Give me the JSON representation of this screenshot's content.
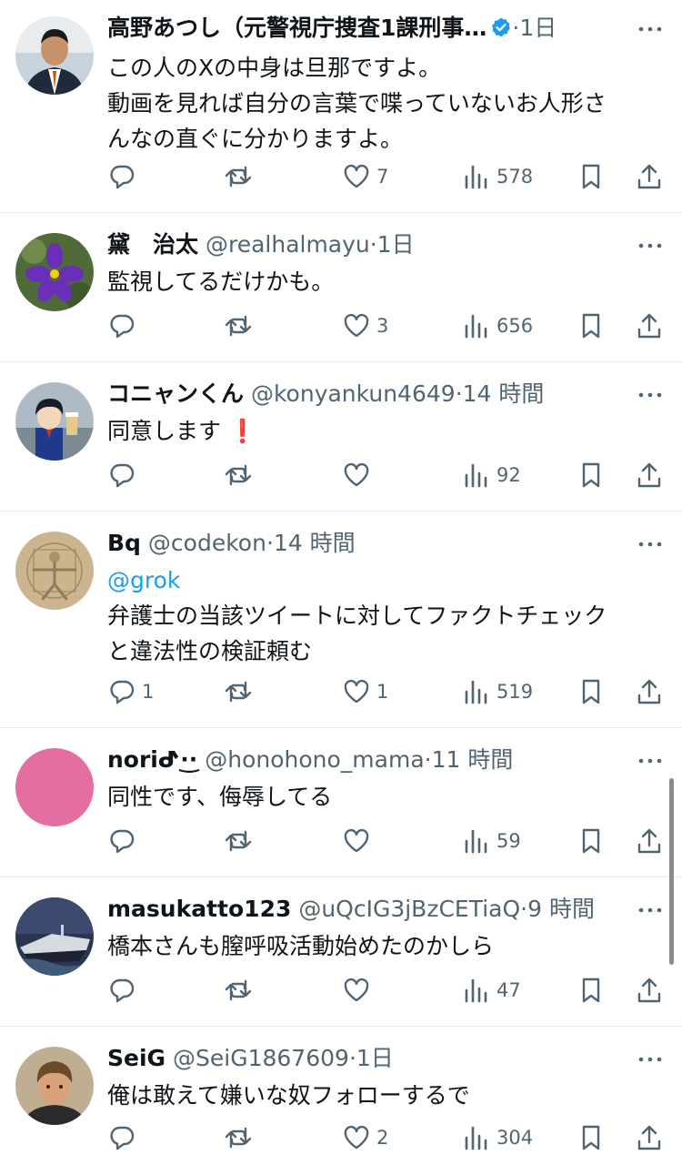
{
  "tweets": [
    {
      "name": "高野あつし（元警視庁捜査1課刑事…",
      "handle": "",
      "time": "1日",
      "verified": true,
      "text_lines": [
        "この人のXの中身は旦那ですよ。",
        "動画を見れば自分の言葉で喋っていないお人形さ",
        "んなの直ぐに分かりますよ。"
      ],
      "replies": "",
      "reposts": "",
      "likes": "7",
      "views": "578"
    },
    {
      "name": "黛　治太",
      "handle": "@realhalmayu",
      "time": "1日",
      "verified": false,
      "text_lines": [
        "監視してるだけかも。"
      ],
      "replies": "",
      "reposts": "",
      "likes": "3",
      "views": "656"
    },
    {
      "name": "コニャンくん",
      "handle": "@konyankun4649",
      "time": "14 時間",
      "verified": false,
      "text_lines": [
        "同意します"
      ],
      "emoji": "❗",
      "replies": "",
      "reposts": "",
      "likes": "",
      "views": "92"
    },
    {
      "name": "Bq",
      "handle": "@codekon",
      "time": "14 時間",
      "verified": false,
      "mention": "@grok",
      "text_lines": [
        "弁護士の当該ツイートに対してファクトチェック",
        "と違法性の検証頼む"
      ],
      "replies": "1",
      "reposts": "",
      "likes": "1",
      "views": "519"
    },
    {
      "name": "noriᕷ·͜·",
      "handle": "@honohono_mama",
      "time": "11 時間",
      "verified": false,
      "text_lines": [
        "同性です、侮辱してる"
      ],
      "replies": "",
      "reposts": "",
      "likes": "",
      "views": "59"
    },
    {
      "name": "masukatto123",
      "handle": "@uQcIG3jBzCETiaQ",
      "time": "9 時間",
      "verified": false,
      "text_lines": [
        "橋本さんも膣呼吸活動始めたのかしら"
      ],
      "replies": "",
      "reposts": "",
      "likes": "",
      "views": "47"
    },
    {
      "name": "SeiG",
      "handle": "@SeiG1867609",
      "time": "1日",
      "verified": false,
      "text_lines": [
        "俺は敢えて嫌いな奴フォローするで"
      ],
      "replies": "",
      "reposts": "",
      "likes": "2",
      "views": "304"
    }
  ],
  "separator": "·",
  "icons": {
    "reply": "reply-icon",
    "repost": "repost-icon",
    "like": "like-icon",
    "views": "views-icon",
    "bookmark": "bookmark-icon",
    "share": "share-icon",
    "more": "more-icon",
    "verified": "verified-badge-icon"
  },
  "colors": {
    "text": "#0f1419",
    "secondary": "#536471",
    "link": "#1d9bf0",
    "verified": "#1d9bf0",
    "divider": "#e6ecf0",
    "emoji": "#e0245e"
  }
}
